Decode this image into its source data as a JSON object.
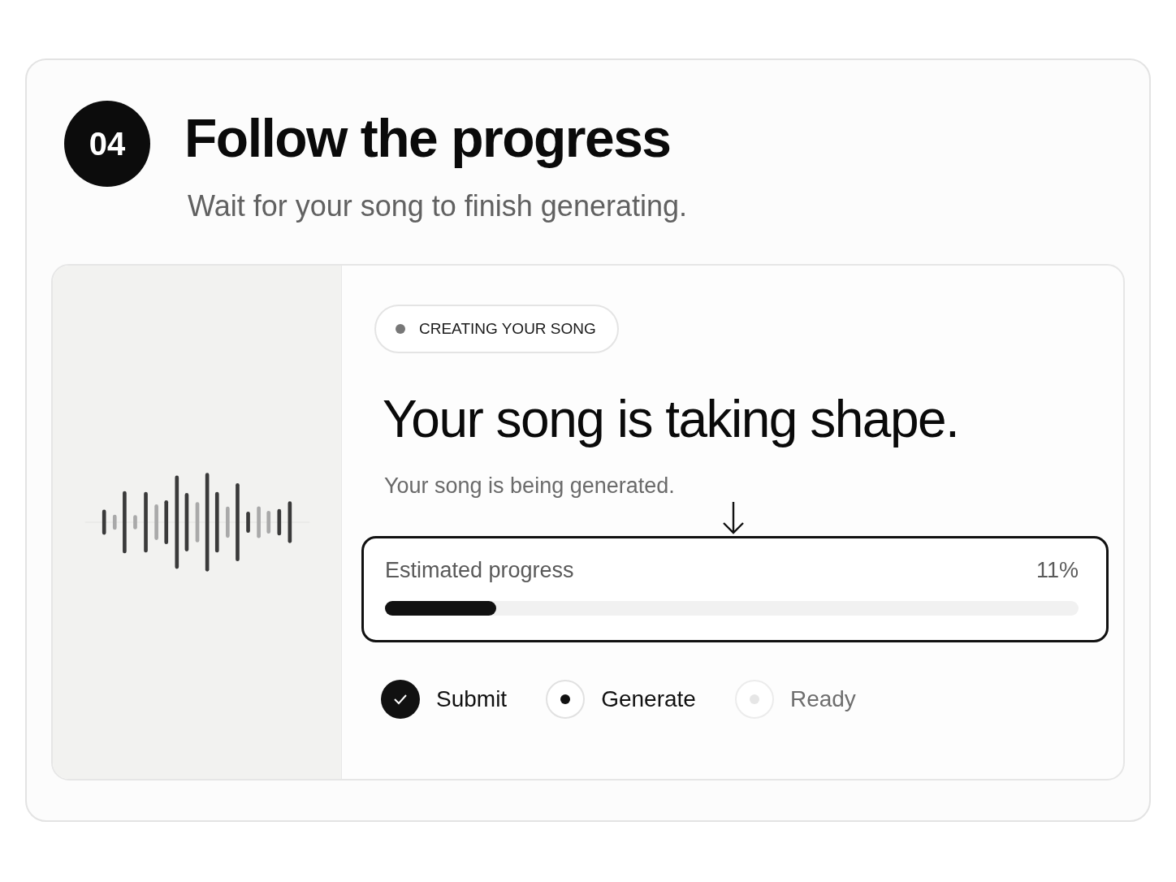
{
  "step": {
    "number": "04",
    "title": "Follow the progress",
    "subtitle": "Wait for your song to finish generating."
  },
  "status_pill": {
    "label": "CREATING YOUR SONG"
  },
  "headline": "Your song is taking shape.",
  "message": "Your song is being generated.",
  "progress": {
    "label": "Estimated progress",
    "reading": "11%",
    "level": 0.16
  },
  "stages": [
    {
      "label": "Submit",
      "kind": "done"
    },
    {
      "label": "Generate",
      "kind": "active"
    },
    {
      "label": "Ready",
      "kind": "pending"
    }
  ]
}
